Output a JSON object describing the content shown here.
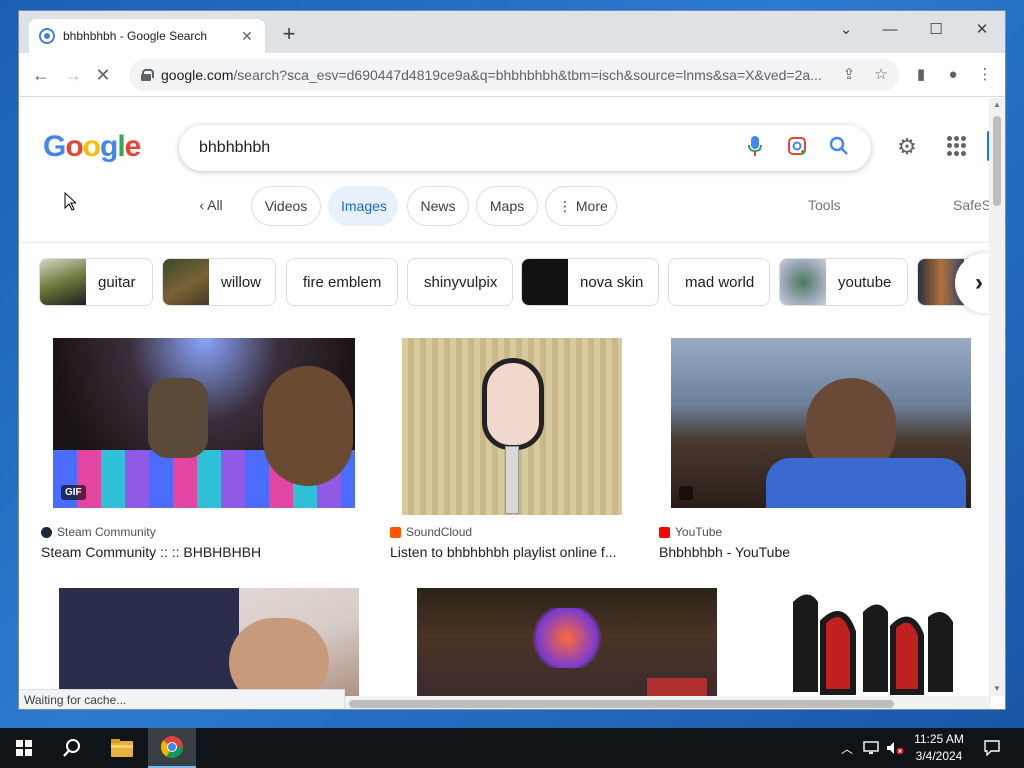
{
  "browser": {
    "tab_title": "bhbhbhbh - Google Search",
    "url_host": "google.com",
    "url_path": "/search?sca_esv=d690447d4819ce9a&q=bhbhbhbh&tbm=isch&source=lnms&sa=X&ved=2a...",
    "status_text": "Waiting for cache..."
  },
  "search": {
    "query": "bhbhbhbh"
  },
  "logo": [
    "G",
    "o",
    "o",
    "g",
    "l",
    "e"
  ],
  "colors": {
    "google_blue": "#4285f4",
    "google_red": "#ea4335",
    "google_yellow": "#fbbc05",
    "google_green": "#34a853",
    "active_chip_bg": "#e8f0fe",
    "active_chip_text": "#1967d2"
  },
  "filters": {
    "all": "All",
    "videos": "Videos",
    "images": "Images",
    "news": "News",
    "maps": "Maps",
    "more": "More",
    "tools": "Tools",
    "safesearch": "SafeS"
  },
  "related": [
    {
      "label": "guitar",
      "thumb_color": "#5a6b3a"
    },
    {
      "label": "willow",
      "thumb_color": "#6b5a3a"
    },
    {
      "label": "fire emblem"
    },
    {
      "label": "shinyvulpix"
    },
    {
      "label": "nova skin",
      "thumb_color": "#151515"
    },
    {
      "label": "mad world"
    },
    {
      "label": "youtube",
      "thumb_color": "#8a9ab0"
    }
  ],
  "results": [
    {
      "source": "Steam Community",
      "title": "Steam Community :: :: BHBHBHBH",
      "badge": "GIF"
    },
    {
      "source": "SoundCloud",
      "title": "Listen to bhbhbhbh playlist online f..."
    },
    {
      "source": "YouTube",
      "title": "Bhbhbhbh - YouTube"
    }
  ],
  "taskbar": {
    "time": "11:25 AM",
    "date": "3/4/2024"
  }
}
